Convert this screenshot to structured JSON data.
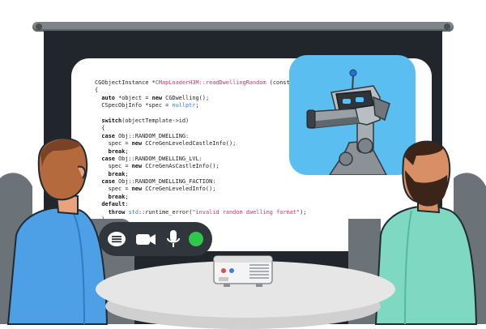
{
  "slide": {
    "code_lines": [
      {
        "parts": [
          {
            "t": "CGObjectInstance *"
          },
          {
            "t": "CMapLoaderH3M::readDwellingRandom",
            "c": "fn"
          },
          {
            "t": " (const in"
          }
        ]
      },
      {
        "parts": [
          {
            "t": "{"
          }
        ]
      },
      {
        "parts": [
          {
            "t": "  "
          },
          {
            "t": "auto",
            "c": "kw"
          },
          {
            "t": " *object = "
          },
          {
            "t": "new",
            "c": "kw"
          },
          {
            "t": " CGDwelling();"
          }
        ]
      },
      {
        "parts": [
          {
            "t": "  CSpecObjInfo *spec = "
          },
          {
            "t": "nullptr",
            "c": "nul"
          },
          {
            "t": ";"
          }
        ]
      },
      {
        "parts": [
          {
            "t": ""
          }
        ]
      },
      {
        "parts": [
          {
            "t": "  "
          },
          {
            "t": "switch",
            "c": "kw"
          },
          {
            "t": "(objectTemplate->id)"
          }
        ]
      },
      {
        "parts": [
          {
            "t": "  {"
          }
        ]
      },
      {
        "parts": [
          {
            "t": "  "
          },
          {
            "t": "case",
            "c": "kw"
          },
          {
            "t": " Obj::RANDOM_DWELLING:"
          }
        ]
      },
      {
        "parts": [
          {
            "t": "    spec = "
          },
          {
            "t": "new",
            "c": "kw"
          },
          {
            "t": " CCreGenLeveledCastleInfo();"
          }
        ]
      },
      {
        "parts": [
          {
            "t": "    "
          },
          {
            "t": "break",
            "c": "kw"
          },
          {
            "t": ";"
          }
        ]
      },
      {
        "parts": [
          {
            "t": "  "
          },
          {
            "t": "case",
            "c": "kw"
          },
          {
            "t": " Obj::RANDOM_DWELLING_LVL:"
          }
        ]
      },
      {
        "parts": [
          {
            "t": "    spec = "
          },
          {
            "t": "new",
            "c": "kw"
          },
          {
            "t": " CCreGenAsCastleInfo();"
          }
        ]
      },
      {
        "parts": [
          {
            "t": "    "
          },
          {
            "t": "break",
            "c": "kw"
          },
          {
            "t": ";"
          }
        ]
      },
      {
        "parts": [
          {
            "t": "  "
          },
          {
            "t": "case",
            "c": "kw"
          },
          {
            "t": " Obj::RANDOM_DWELLING_FACTION:"
          }
        ]
      },
      {
        "parts": [
          {
            "t": "    spec = "
          },
          {
            "t": "new",
            "c": "kw"
          },
          {
            "t": " CCreGenLeveledInfo();"
          }
        ]
      },
      {
        "parts": [
          {
            "t": "    "
          },
          {
            "t": "break",
            "c": "kw"
          },
          {
            "t": ";"
          }
        ]
      },
      {
        "parts": [
          {
            "t": "  "
          },
          {
            "t": "default",
            "c": "kw"
          },
          {
            "t": ":"
          }
        ]
      },
      {
        "parts": [
          {
            "t": "    "
          },
          {
            "t": "throw",
            "c": "kw"
          },
          {
            "t": " "
          },
          {
            "t": "std",
            "c": "ns"
          },
          {
            "t": "::runtime_error("
          },
          {
            "t": "\"invalid random dwelling format\"",
            "c": "str"
          },
          {
            "t": ");"
          }
        ]
      },
      {
        "parts": [
          {
            "t": "  }"
          }
        ]
      }
    ]
  },
  "controls": {
    "items": [
      {
        "name": "chat-icon-button"
      },
      {
        "name": "camera-icon-button"
      },
      {
        "name": "microphone-icon-button"
      },
      {
        "name": "status-indicator-button"
      }
    ],
    "bar_color": "#30363b",
    "status_color": "#2fc84a"
  },
  "colors": {
    "screen": "#20262b",
    "video_bg": "#5bbef0",
    "keyword": "#111111",
    "function_name": "#d2356a",
    "literal": "#2a7be0"
  }
}
